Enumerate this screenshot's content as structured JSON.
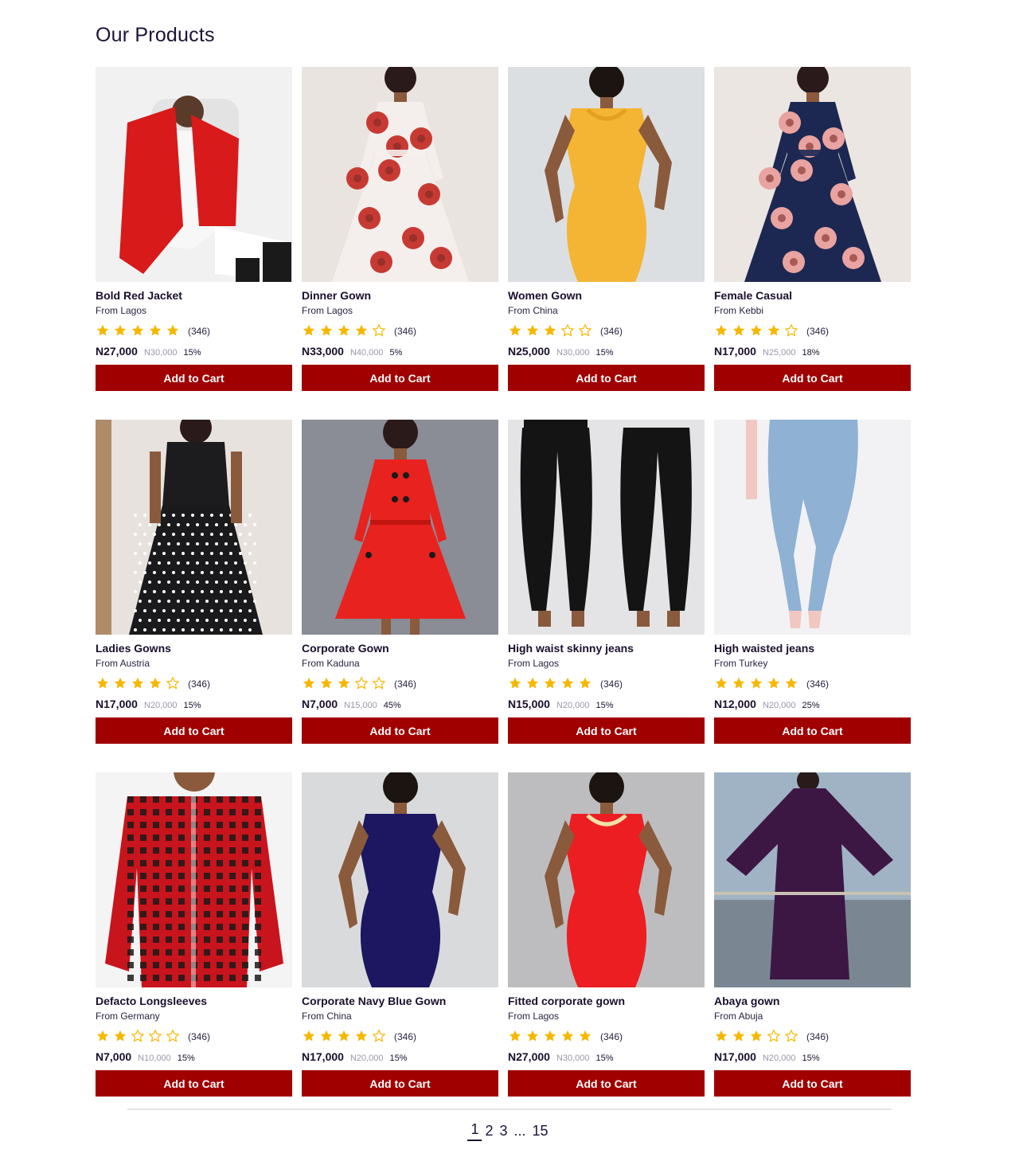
{
  "section_title": "Our Products",
  "colors": {
    "accent": "#a00000",
    "star": "#f5b800",
    "text": "#1a0f2e"
  },
  "products": [
    {
      "title": "Bold Red Jacket",
      "origin": "From Lagos",
      "rating": 5,
      "reviews": "(346)",
      "price": "N27,000",
      "old_price": "N30,000",
      "discount": "15%",
      "cart_label": "Add to Cart",
      "photo": {
        "bg": "#f1f1f1",
        "garment": "#d81a1a",
        "accent": "#ffffff",
        "style": "jacket"
      }
    },
    {
      "title": "Dinner Gown",
      "origin": "From Lagos",
      "rating": 4,
      "reviews": "(346)",
      "price": "N33,000",
      "old_price": "N40,000",
      "discount": "5%",
      "cart_label": "Add to Cart",
      "photo": {
        "bg": "#e9e4df",
        "garment": "#f4efec",
        "accent": "#c73a33",
        "style": "floral"
      }
    },
    {
      "title": "Women Gown",
      "origin": "From China",
      "rating": 3,
      "reviews": "(346)",
      "price": "N25,000",
      "old_price": "N30,000",
      "discount": "15%",
      "cart_label": "Add to Cart",
      "photo": {
        "bg": "#dcdfe2",
        "garment": "#f4b534",
        "accent": "#e49f1f",
        "style": "fitted"
      }
    },
    {
      "title": "Female Casual",
      "origin": "From Kebbi",
      "rating": 4,
      "reviews": "(346)",
      "price": "N17,000",
      "old_price": "N25,000",
      "discount": "18%",
      "cart_label": "Add to Cart",
      "photo": {
        "bg": "#ece6e2",
        "garment": "#1d2852",
        "accent": "#e9a3a0",
        "style": "floral"
      }
    },
    {
      "title": "Ladies Gowns",
      "origin": "From Austria",
      "rating": 4,
      "reviews": "(346)",
      "price": "N17,000",
      "old_price": "N20,000",
      "discount": "15%",
      "cart_label": "Add to Cart",
      "photo": {
        "bg": "#e7e2dd",
        "garment": "#1a1a1c",
        "accent": "#ffffff",
        "style": "polka"
      }
    },
    {
      "title": "Corporate Gown",
      "origin": "From Kaduna",
      "rating": 3,
      "reviews": "(346)",
      "price": "N7,000",
      "old_price": "N15,000",
      "discount": "45%",
      "cart_label": "Add to Cart",
      "photo": {
        "bg": "#8a8c96",
        "garment": "#e8221e",
        "accent": "#1a1a1a",
        "style": "aline"
      }
    },
    {
      "title": "High waist skinny jeans",
      "origin": "From Lagos",
      "rating": 5,
      "reviews": "(346)",
      "price": "N15,000",
      "old_price": "N20,000",
      "discount": "15%",
      "cart_label": "Add to Cart",
      "photo": {
        "bg": "#e4e4e6",
        "garment": "#141414",
        "accent": "#141414",
        "style": "jeans"
      }
    },
    {
      "title": "High waisted jeans",
      "origin": "From Turkey",
      "rating": 5,
      "reviews": "(346)",
      "price": "N12,000",
      "old_price": "N20,000",
      "discount": "25%",
      "cart_label": "Add to Cart",
      "photo": {
        "bg": "#f2f2f4",
        "garment": "#8eb1d4",
        "accent": "#f2c7c2",
        "style": "jeans-single"
      }
    },
    {
      "title": "Defacto Longsleeves",
      "origin": "From Germany",
      "rating": 2,
      "reviews": "(346)",
      "price": "N7,000",
      "old_price": "N10,000",
      "discount": "15%",
      "cart_label": "Add to Cart",
      "photo": {
        "bg": "#f4f4f4",
        "garment": "#c8141c",
        "accent": "#1a1a1a",
        "style": "plaid"
      }
    },
    {
      "title": "Corporate Navy Blue Gown",
      "origin": "From China",
      "rating": 4,
      "reviews": "(346)",
      "price": "N17,000",
      "old_price": "N20,000",
      "discount": "15%",
      "cart_label": "Add to Cart",
      "photo": {
        "bg": "#d9dadc",
        "garment": "#1c1760",
        "accent": "#1c1760",
        "style": "fitted"
      }
    },
    {
      "title": "Fitted corporate gown",
      "origin": "From Lagos",
      "rating": 5,
      "reviews": "(346)",
      "price": "N27,000",
      "old_price": "N30,000",
      "discount": "15%",
      "cart_label": "Add to Cart",
      "photo": {
        "bg": "#bdbdbf",
        "garment": "#ec1e22",
        "accent": "#f3e0a8",
        "style": "fitted"
      }
    },
    {
      "title": "Abaya gown",
      "origin": "From Abuja",
      "rating": 3,
      "reviews": "(346)",
      "price": "N17,000",
      "old_price": "N20,000",
      "discount": "15%",
      "cart_label": "Add to Cart",
      "photo": {
        "bg": "#9fb3c4",
        "garment": "#3d1744",
        "accent": "#c9c2b3",
        "style": "abaya"
      }
    }
  ],
  "pagination": {
    "pages": [
      "1",
      "2",
      "3"
    ],
    "current": "1",
    "ellipsis": "...",
    "last": "15"
  }
}
